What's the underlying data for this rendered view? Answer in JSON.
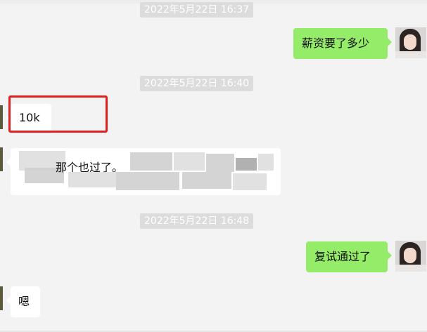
{
  "timestamps": [
    "2022年5月22日 16:37",
    "2022年5月22日 16:40",
    "2022年5月22日 16:48"
  ],
  "messages": {
    "salary_question": "薪资要了多少",
    "salary_answer": "10k",
    "blurred_visible_text": "那个也过了。",
    "retest_passed": "复试通过了",
    "reply_ok": "嗯"
  },
  "colors": {
    "sent_bubble": "#95ec69",
    "received_bubble": "#ffffff",
    "highlight_box": "#e21f1f",
    "background": "#f3f3f3"
  }
}
